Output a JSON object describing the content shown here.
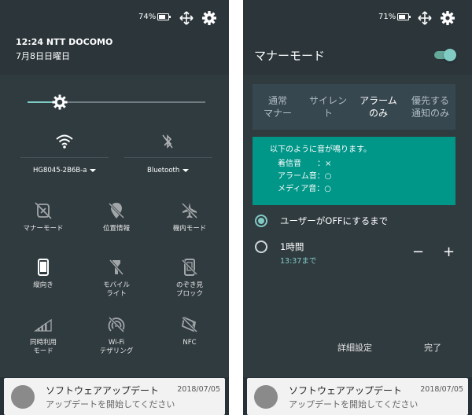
{
  "left": {
    "status": {
      "battery": "74%",
      "battery_level": 0.74
    },
    "header": {
      "time_carrier": "12:24  NTT DOCOMO",
      "date": "7月8日日曜日"
    },
    "brightness": {
      "level": 0.18
    },
    "network_tiles": [
      {
        "label": "HG8045-2B6B-a",
        "icon": "wifi-icon"
      },
      {
        "label": "Bluetooth",
        "icon": "bluetooth-off-icon"
      }
    ],
    "tiles": [
      {
        "label": "マナーモード",
        "icon": "manner-mode-icon"
      },
      {
        "label": "位置情報",
        "icon": "location-off-icon"
      },
      {
        "label": "機内モード",
        "icon": "airplane-off-icon"
      },
      {
        "label": "縦向き",
        "icon": "portrait-icon"
      },
      {
        "label": "モバイル\nライト",
        "icon": "flashlight-off-icon"
      },
      {
        "label": "のぞき見\nブロック",
        "icon": "peek-block-icon"
      },
      {
        "label": "同時利用\nモード",
        "icon": "dual-use-icon"
      },
      {
        "label": "Wi-Fi\nテザリング",
        "icon": "hotspot-off-icon"
      },
      {
        "label": "NFC",
        "icon": "nfc-off-icon"
      }
    ]
  },
  "right": {
    "status": {
      "battery": "71%",
      "battery_level": 0.71
    },
    "title": "マナーモード",
    "toggle_on": true,
    "mode_tabs": [
      {
        "label": "通常\nマナー",
        "active": false
      },
      {
        "label": "サイレン\nト",
        "active": false
      },
      {
        "label": "アラーム\nのみ",
        "active": true
      },
      {
        "label": "優先する\n通知のみ",
        "active": false
      }
    ],
    "info": {
      "heading": "以下のように音が鳴ります。",
      "lines": [
        "着信音　　：×",
        "アラーム音：○",
        "メディア音：○"
      ]
    },
    "options": [
      {
        "label": "ユーザーがOFFにするまで",
        "selected": true
      },
      {
        "label": "1時間",
        "sub": "13:37まで",
        "selected": false
      }
    ],
    "stepper": {
      "minus": "−",
      "plus": "+"
    },
    "actions": {
      "details": "詳細設定",
      "done": "完了"
    }
  },
  "notification": {
    "title": "ソフトウェアアップデート",
    "time": "2018/07/05",
    "body": "アップデートを開始してください"
  }
}
